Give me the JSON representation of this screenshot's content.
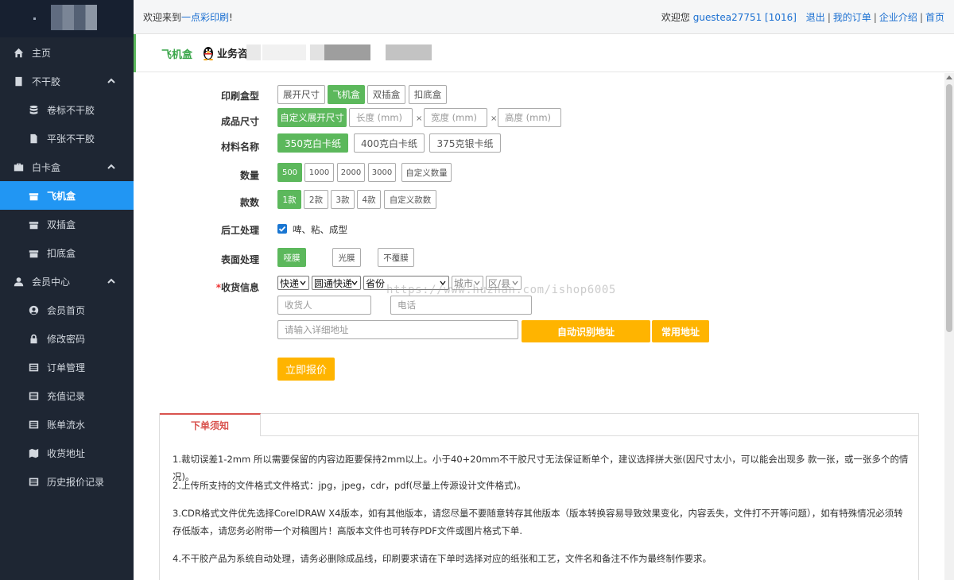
{
  "topbar": {
    "welcome_prefix": "欢迎来到",
    "site_name": "一点彩印刷",
    "welcome_suffix": "!",
    "greeting": "欢迎您",
    "username": "guestea27751 [1016]",
    "logout": "退出",
    "my_orders": "我的订单",
    "company": "企业介绍",
    "home": "首页"
  },
  "sidebar": {
    "home": "主页",
    "group1": "不干胶",
    "g1_items": [
      "卷标不干胶",
      "平张不干胶"
    ],
    "group2": "白卡盒",
    "g2_items": [
      "飞机盒",
      "双插盒",
      "扣底盒"
    ],
    "group3": "会员中心",
    "g3_items": [
      "会员首页",
      "修改密码",
      "订单管理",
      "充值记录",
      "账单流水",
      "收货地址",
      "历史报价记录"
    ]
  },
  "header": {
    "title": "飞机盒",
    "qq_label": "业务咨"
  },
  "form": {
    "box_type": {
      "label": "印刷盒型",
      "options": [
        "展开尺寸",
        "飞机盒",
        "双插盒",
        "扣底盒"
      ],
      "selected": "飞机盒"
    },
    "size": {
      "label": "成品尺寸",
      "custom_btn": "自定义展开尺寸",
      "length_ph": "长度 (mm)",
      "width_ph": "宽度 (mm)",
      "height_ph": "高度 (mm)",
      "sep": "×"
    },
    "material": {
      "label": "材料名称",
      "options": [
        "350克白卡纸",
        "400克白卡纸",
        "375克银卡纸"
      ],
      "selected": "350克白卡纸"
    },
    "quantity": {
      "label": "数量",
      "options": [
        "500",
        "1000",
        "2000",
        "3000",
        "自定义数量"
      ],
      "selected": "500"
    },
    "styles": {
      "label": "款数",
      "options": [
        "1款",
        "2款",
        "3款",
        "4款",
        "自定义款数"
      ],
      "selected": "1款"
    },
    "post": {
      "label": "后工处理",
      "value": "啤、粘、成型",
      "checked": true
    },
    "surface": {
      "label": "表面处理",
      "options": [
        "哑膜",
        "光膜",
        "不覆膜"
      ],
      "selected": "哑膜"
    },
    "shipping": {
      "label": "收货信息",
      "required_mark": "*",
      "method": "快递",
      "carrier": "圆通快递",
      "province": "省份",
      "city": "城市",
      "district": "区/县",
      "receiver_ph": "收货人",
      "phone_ph": "电话",
      "address_ph": "请输入详细地址",
      "auto_detect": "自动识别地址",
      "common_address": "常用地址"
    },
    "quote_btn": "立即报价"
  },
  "watermark": "https://www.huzhan.com/ishop6005",
  "notice": {
    "tab": "下单须知",
    "lines": [
      "1.裁切误差1-2mm 所以需要保留的内容边距要保持2mm以上。小于40+20mm不干胶尺寸无法保证断单个，建议选择拼大张(因尺寸太小，可以能会出现多 款一张，或一张多个的情     况)。",
      "2.上传所支持的文件格式文件格式：jpg，jpeg，cdr，pdf(尽量上传源设计文件格式)。",
      "3.CDR格式文件优先选择CorelDRAW X4版本，如有其他版本，请您尽量不要随意转存其他版本（版本转换容易导致效果变化，内容丢失，文件打不开等问题），如有特殊情况必须转     存低版本，请您务必附带一个对稿图片！高版本文件也可转存PDF文件或图片格式下单.",
      "4.不干胶产品为系统自动处理，请务必删除成品线，印刷要求请在下单时选择对应的纸张和工艺，文件名和备注不作为最终制作要求。"
    ]
  },
  "colors": {
    "sidebar_bg": "#1e2633",
    "active": "#2196f3",
    "green": "#5cb85c",
    "yellow": "#ffb400",
    "notice_red": "#d9534f"
  }
}
